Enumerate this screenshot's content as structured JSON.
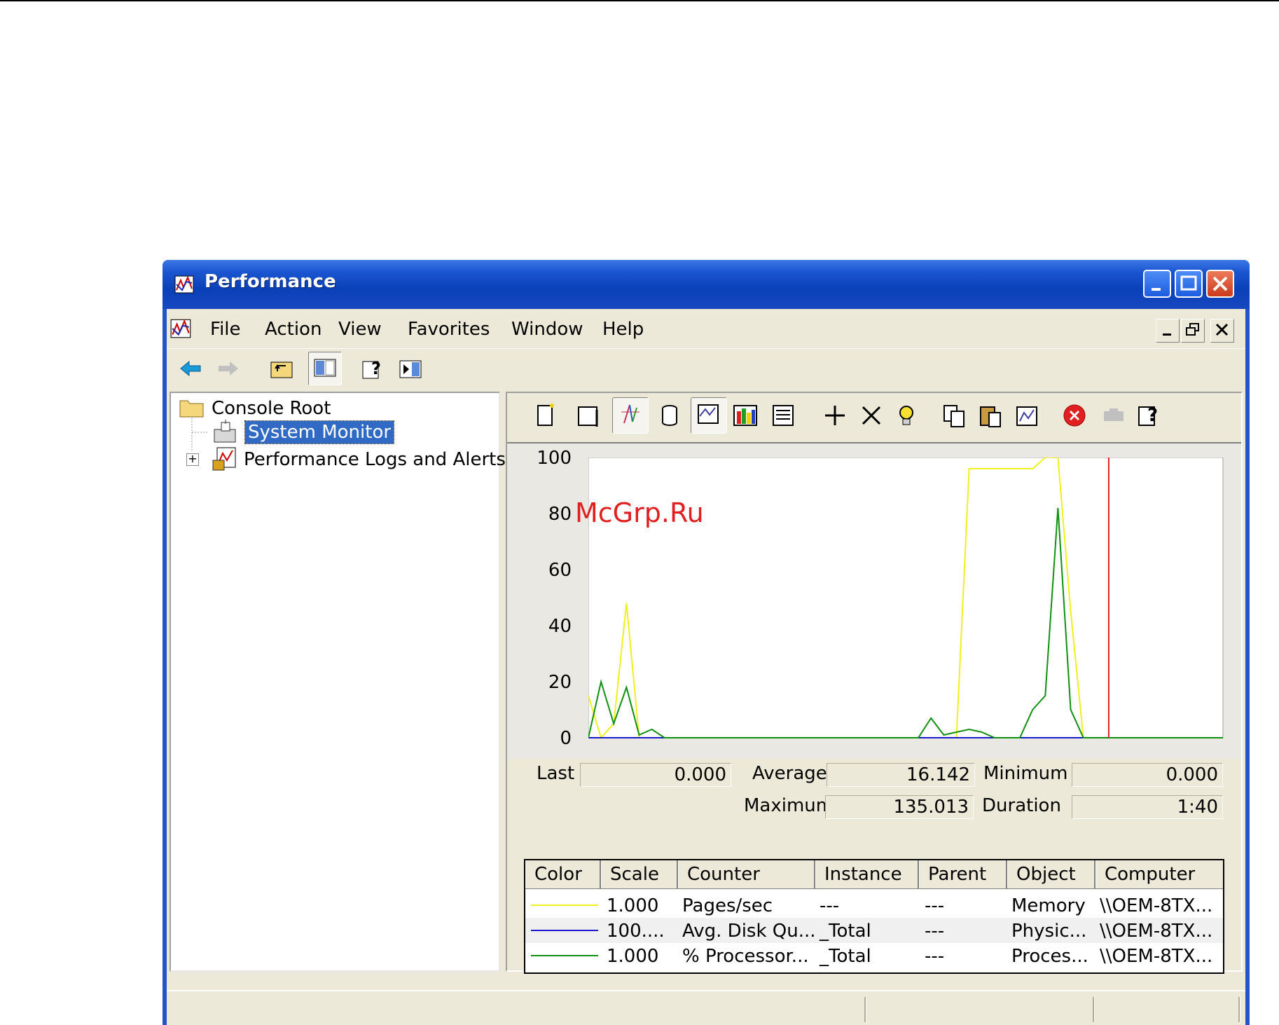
{
  "window": {
    "title": "Performance"
  },
  "menu": [
    "File",
    "Action",
    "View",
    "Favorites",
    "Window",
    "Help"
  ],
  "tree": {
    "root": "Console Root",
    "selected": "System Monitor",
    "child2": "Performance Logs and Alerts",
    "expander": "+"
  },
  "stats": {
    "last_label": "Last",
    "last": "0.000",
    "average_label": "Average",
    "average": "16.142",
    "minimum_label": "Minimum",
    "minimum": "0.000",
    "maximum_label": "Maximum",
    "maximum": "135.013",
    "duration_label": "Duration",
    "duration": "1:40"
  },
  "legend": {
    "columns": [
      "Color",
      "Scale",
      "Counter",
      "Instance",
      "Parent",
      "Object",
      "Computer"
    ],
    "rows": [
      {
        "color": "#f0f020",
        "scale": "1.000",
        "counter": "Pages/sec",
        "instance": "---",
        "parent": "---",
        "object": "Memory",
        "computer": "\\\\OEM-8TX..."
      },
      {
        "color": "#1a1acc",
        "scale": "100....",
        "counter": "Avg. Disk Qu...",
        "instance": "_Total",
        "parent": "---",
        "object": "Physic...",
        "computer": "\\\\OEM-8TX..."
      },
      {
        "color": "#109010",
        "scale": "1.000",
        "counter": "% Processor...",
        "instance": "_Total",
        "parent": "---",
        "object": "Proces...",
        "computer": "\\\\OEM-8TX..."
      }
    ]
  },
  "chart_data": {
    "type": "line",
    "ylim": [
      0,
      100
    ],
    "yticks": [
      "100",
      "80",
      "60",
      "40",
      "20",
      "0"
    ],
    "x": [
      0,
      2,
      4,
      6,
      8,
      10,
      12,
      14,
      16,
      18,
      20,
      30,
      40,
      50,
      52,
      54,
      56,
      58,
      60,
      62,
      64,
      66,
      68,
      70,
      72,
      74,
      76,
      78,
      80,
      85,
      90,
      95,
      100
    ],
    "series": [
      {
        "name": "Pages/sec",
        "color": "#f0f020",
        "values": [
          15,
          0,
          5,
          48,
          0,
          0,
          0,
          0,
          0,
          0,
          0,
          0,
          0,
          0,
          0,
          0,
          0,
          0,
          96,
          96,
          96,
          96,
          96,
          96,
          100,
          100,
          45,
          0,
          0,
          0,
          0,
          0,
          0
        ]
      },
      {
        "name": "Avg. Disk Qu...",
        "color": "#1a1acc",
        "values": [
          0,
          0,
          0,
          0,
          0,
          0,
          0,
          0,
          0,
          0,
          0,
          0,
          0,
          0,
          0,
          0,
          0,
          0,
          0,
          0,
          0,
          0,
          0,
          0,
          0,
          0,
          0,
          0,
          0,
          0,
          0,
          0,
          0
        ]
      },
      {
        "name": "% Processor...",
        "color": "#109010",
        "values": [
          0,
          20,
          5,
          18,
          1,
          3,
          0,
          0,
          0,
          0,
          0,
          0,
          0,
          0,
          0,
          7,
          1,
          2,
          3,
          2,
          0,
          0,
          0,
          10,
          15,
          82,
          10,
          0,
          0,
          0,
          0,
          0,
          0
        ]
      }
    ],
    "marker_x": 82,
    "marker_color": "#e02020"
  },
  "watermark": "McGrp.Ru"
}
